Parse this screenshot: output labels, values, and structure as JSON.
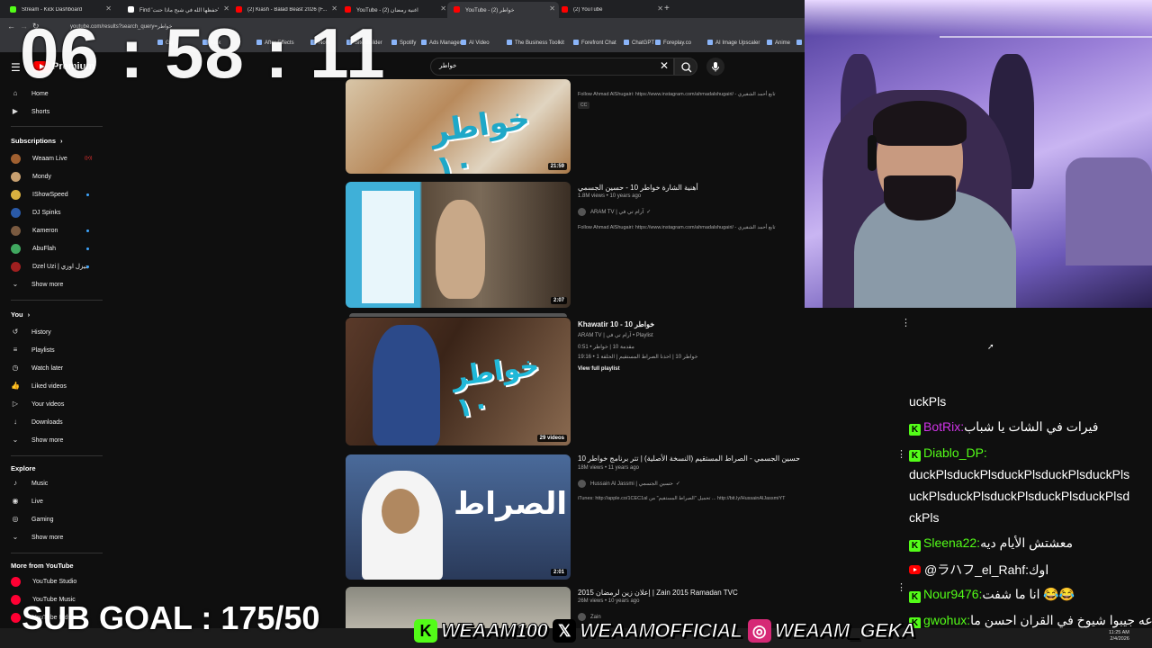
{
  "browser": {
    "tabs": [
      {
        "label": "Stream - Kick Dashboard",
        "color": "#53fc18"
      },
      {
        "label": "Find 'حفظها الله في شبح ماذا حنت' ...",
        "color": "#ffffff"
      },
      {
        "label": "(2) Kiash - Balad Beast 2026 (F...",
        "color": "#ff0000"
      },
      {
        "label": "YouTube - اغنية رمضان (2)",
        "color": "#ff0000"
      },
      {
        "label": "YouTube - خواطر (2)",
        "color": "#ff0000"
      },
      {
        "label": "(2) YouTube",
        "color": "#ff0000"
      }
    ],
    "url": "youtube.com/results?search_query=خواطر",
    "bookmarks": [
      "Gg",
      "Kick",
      "After Effects",
      "Note",
      "Site Builder",
      "Spotify",
      "Ads Manager",
      "AI Video",
      "The Business Toolkit",
      "Forefront Chat",
      "ChatGPT",
      "Foreplay.co",
      "AI Image Upscaler",
      "Anime",
      "Be"
    ]
  },
  "youtube": {
    "logo_text": "Premium",
    "search_query": "خواطر"
  },
  "sidebar": {
    "main": [
      {
        "label": "Home",
        "icon": "home-icon"
      },
      {
        "label": "Shorts",
        "icon": "shorts-icon"
      }
    ],
    "subscriptions_header": "Subscriptions",
    "subscriptions": [
      {
        "label": "Weaam Live",
        "color": "#a06030",
        "live": true
      },
      {
        "label": "Mondy",
        "color": "#c8a070"
      },
      {
        "label": "IShowSpeed",
        "color": "#d8b040"
      },
      {
        "label": "DJ Spinks",
        "color": "#2a5aa8"
      },
      {
        "label": "Kameron",
        "color": "#7a5a40"
      },
      {
        "label": "AbuFlah",
        "color": "#40a860"
      },
      {
        "label": "Dzel Uzi | جيزل اوزي",
        "color": "#a02020"
      }
    ],
    "show_more": "Show more",
    "you_header": "You",
    "you": [
      {
        "label": "History",
        "icon": "history-icon"
      },
      {
        "label": "Playlists",
        "icon": "playlists-icon"
      },
      {
        "label": "Watch later",
        "icon": "watch-later-icon"
      },
      {
        "label": "Liked videos",
        "icon": "liked-icon"
      },
      {
        "label": "Your videos",
        "icon": "your-videos-icon"
      },
      {
        "label": "Downloads",
        "icon": "downloads-icon"
      }
    ],
    "explore_header": "Explore",
    "explore": [
      {
        "label": "Music",
        "icon": "music-icon"
      },
      {
        "label": "Live",
        "icon": "live-icon"
      },
      {
        "label": "Gaming",
        "icon": "gaming-icon"
      }
    ],
    "more_header": "More from YouTube",
    "more": [
      {
        "label": "YouTube Studio"
      },
      {
        "label": "YouTube Music"
      },
      {
        "label": "YouTube Kids"
      }
    ]
  },
  "results": [
    {
      "duration": "21:59",
      "desc": "Follow Ahmad AlShugairi: https://www.instagram.com/ahmadalshugairi/ - تابع أحمد الشقيري",
      "cc": "CC"
    },
    {
      "title": "أهنية الشارة خواطر 10 - حسين الجسمي",
      "meta": "1.8M views • 10 years ago",
      "channel": "ARAM TV | آرام تي في",
      "desc": "Follow Ahmad AlShugairi: https://www.instagram.com/ahmadalshugairi/ - تابع أحمد الشقيري",
      "duration": "2:07"
    },
    {
      "title": "Khawatir 10 - خواطر 10",
      "meta": "ARAM TV | آرام تي في • Playlist",
      "line1": "0:51 • مقدمة 10 | خواطر",
      "line2": "19:16 • 1 خواطر 10 | احذنا الصراط المستقيم | الحلقة",
      "view_full": "View full playlist",
      "duration": "29 videos"
    },
    {
      "title": "حسين الجسمي - الصراط المستقيم (النسخة الأصلية) | تتر برنامج خواطر 10",
      "meta": "18M views • 11 years ago",
      "channel": "Hussain Al Jassmi | حسين الجسمي",
      "desc": "iTunes: http://apple.co/1CEC1al تحميل \"الصراط المستقيم\" من ... http://bit.ly/HussainAlJassmiYT",
      "duration": "2:01"
    },
    {
      "title": "2015 إعلان زين لرمضان | Zain 2015 Ramadan TVC",
      "meta": "26M views • 10 years ago",
      "channel": "Zain"
    }
  ],
  "chat": [
    {
      "user": "",
      "text": "uckPls",
      "color": "#ffffff",
      "badge": "none"
    },
    {
      "user": "BotRix:",
      "text": "فيرات في الشات يا شباب",
      "color": "#d034e8",
      "badge": "kick"
    },
    {
      "user": "Diablo_DP:",
      "text": "",
      "color": "#53fc18",
      "badge": "kick"
    },
    {
      "user": "",
      "text": "duckPlsduckPlsduckPlsduckPlsduckPls",
      "color": "#ffffff",
      "badge": "none"
    },
    {
      "user": "",
      "text": "uckPlsduckPlsduckPlsduckPlsduckPlsd",
      "color": "#ffffff",
      "badge": "none"
    },
    {
      "user": "",
      "text": "ckPls",
      "color": "#ffffff",
      "badge": "none"
    },
    {
      "user": "Sleena22:",
      "text": "معشتش الأيام ديه",
      "color": "#53fc18",
      "badge": "kick"
    },
    {
      "user": "@ラハフ_el_Rahf:",
      "text": "اوك",
      "color": "#ffffff",
      "badge": "youtube"
    },
    {
      "user": "Nour9476:",
      "text": "انا ما شفت 😂😂",
      "color": "#53fc18",
      "badge": "kick"
    },
    {
      "user": "gwohux:",
      "text": "جماعه جيبوا شيوخ في القران احسن ما",
      "color": "#53fc18",
      "badge": "kick"
    }
  ],
  "overlay": {
    "timer": "06 : 58 : 11",
    "sub_goal": "SUB GOAL : 175/50",
    "socials": [
      {
        "label": "WEAAM100",
        "icon": "kick-icon",
        "color": "#53fc18"
      },
      {
        "label": "WEAAMOFFICIAL",
        "icon": "x-icon",
        "color": "#000000"
      },
      {
        "label": "WEAAM_GEKA",
        "icon": "instagram-icon",
        "color": "#d62976"
      }
    ]
  },
  "taskbar": {
    "time": "11:25 AM",
    "date": "2/4/2026"
  }
}
